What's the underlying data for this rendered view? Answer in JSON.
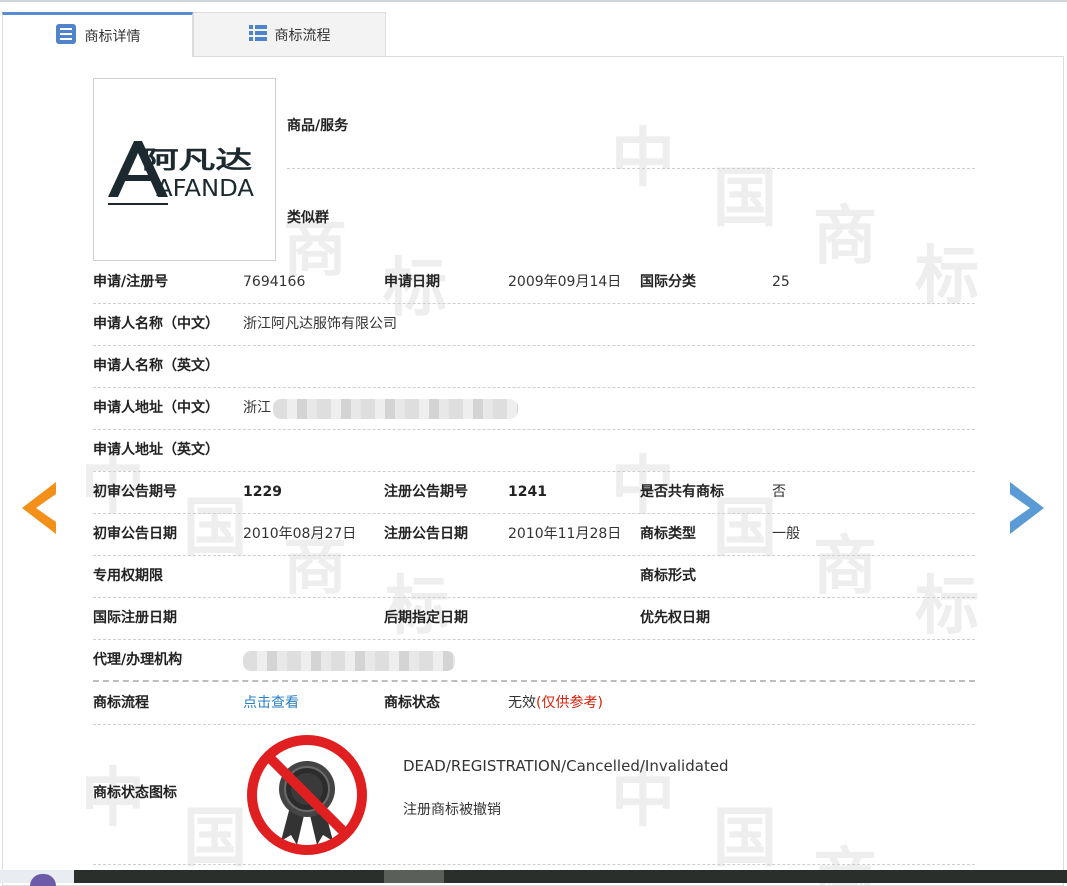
{
  "tabs": [
    {
      "label": "商标详情",
      "icon": "document-list-icon",
      "active": true
    },
    {
      "label": "商标流程",
      "icon": "list-icon",
      "active": false
    }
  ],
  "watermark": {
    "chars": [
      "中",
      "国",
      "商",
      "标"
    ]
  },
  "logo": {
    "cn_text": "阿凡达",
    "en_text": "AFANDA"
  },
  "goods": {
    "label": "商品/服务",
    "value": ""
  },
  "similar_group": {
    "label": "类似群",
    "value": ""
  },
  "fields": {
    "reg_no": {
      "label": "申请/注册号",
      "value": "7694166"
    },
    "app_date": {
      "label": "申请日期",
      "value": "2009年09月14日"
    },
    "intl_class": {
      "label": "国际分类",
      "value": "25"
    },
    "applicant_cn": {
      "label": "申请人名称（中文）",
      "value": "浙江阿凡达服饰有限公司"
    },
    "applicant_en": {
      "label": "申请人名称（英文）",
      "value": ""
    },
    "address_cn": {
      "label": "申请人地址（中文）",
      "value": "浙江"
    },
    "address_en": {
      "label": "申请人地址（英文）",
      "value": ""
    },
    "prelim_pub_no": {
      "label": "初审公告期号",
      "value": "1229"
    },
    "reg_pub_no": {
      "label": "注册公告期号",
      "value": "1241"
    },
    "shared": {
      "label": "是否共有商标",
      "value": "否"
    },
    "prelim_pub_date": {
      "label": "初审公告日期",
      "value": "2010年08月27日"
    },
    "reg_pub_date": {
      "label": "注册公告日期",
      "value": "2010年11月28日"
    },
    "tm_type": {
      "label": "商标类型",
      "value": "一般"
    },
    "exclusive_period": {
      "label": "专用权期限",
      "value": ""
    },
    "tm_form": {
      "label": "商标形式",
      "value": ""
    },
    "intl_reg_date": {
      "label": "国际注册日期",
      "value": ""
    },
    "later_designation_date": {
      "label": "后期指定日期",
      "value": ""
    },
    "priority_date": {
      "label": "优先权日期",
      "value": ""
    },
    "agent": {
      "label": "代理/办理机构",
      "value": ""
    },
    "process": {
      "label": "商标流程",
      "value": "点击查看"
    },
    "status": {
      "label": "商标状态",
      "value": "无效",
      "note": "(仅供参考)"
    },
    "status_icon": {
      "label": "商标状态图标"
    }
  },
  "status_detail": {
    "en": "DEAD/REGISTRATION/Cancelled/Invalidated",
    "cn": "注册商标被撤销",
    "icon": "dead-registration-seal-icon"
  },
  "nav": {
    "prev_icon": "prev-arrow-icon",
    "next_icon": "next-arrow-icon"
  },
  "colors": {
    "accent": "#5b8bd0",
    "link": "#2a7fc4",
    "warning": "#d81e06",
    "prev_arrow": "#f39019",
    "next_arrow": "#5b9bd5",
    "stop_red": "#e02020"
  }
}
